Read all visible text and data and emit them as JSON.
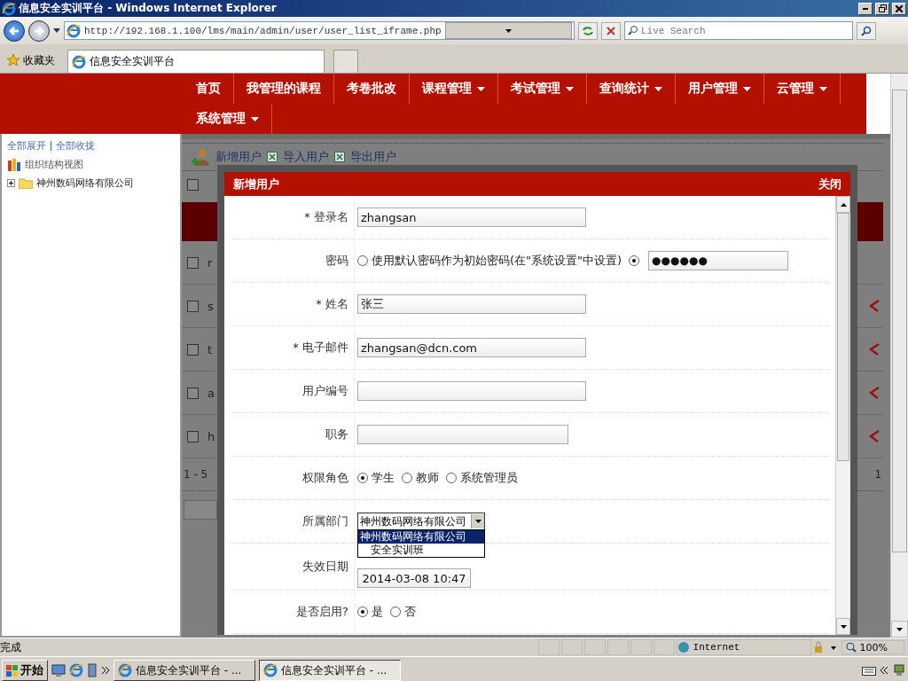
{
  "window": {
    "title": "信息安全实训平台 - Windows Internet Explorer"
  },
  "address_bar": {
    "url": "http://192.168.1.100/lms/main/admin/user/user_list_iframe.php"
  },
  "search": {
    "placeholder": "Live Search"
  },
  "favorites": {
    "label": "收藏夹"
  },
  "tabs": [
    {
      "label": "信息安全实训平台",
      "selected": true
    }
  ],
  "nav": [
    {
      "label": "首页",
      "dropdown": false
    },
    {
      "label": "我管理的课程",
      "dropdown": false
    },
    {
      "label": "考卷批改",
      "dropdown": false
    },
    {
      "label": "课程管理",
      "dropdown": true
    },
    {
      "label": "考试管理",
      "dropdown": true
    },
    {
      "label": "查询统计",
      "dropdown": true
    },
    {
      "label": "用户管理",
      "dropdown": true
    },
    {
      "label": "云管理",
      "dropdown": true
    },
    {
      "label": "系统管理",
      "dropdown": true
    }
  ],
  "sidebar": {
    "links": [
      "全部展开",
      "全部收拢"
    ],
    "root": "组织结构视图",
    "tree": [
      {
        "label": "神州数码网络有限公司",
        "expanded": false
      }
    ]
  },
  "list": {
    "toolbar": [
      "新增用户",
      "导入用户",
      "导出用户"
    ],
    "select_all": {
      "checked": false
    },
    "rows": [
      {
        "column_1": "r",
        "checked": false,
        "deletable": false
      },
      {
        "column_1": "s",
        "checked": false,
        "deletable": true
      },
      {
        "column_1": "t",
        "checked": false,
        "deletable": true
      },
      {
        "column_1": "a",
        "checked": false,
        "deletable": true
      },
      {
        "column_1": "h",
        "checked": false,
        "deletable": true
      }
    ],
    "pager": "1 - 5",
    "pager_end": "1"
  },
  "dialog": {
    "title": "新增用户",
    "close": "关闭",
    "rows": [
      {
        "kind": "text",
        "label": "* 登录名",
        "value": "zhangsan"
      },
      {
        "kind": "password",
        "label": "密码",
        "options": [
          {
            "label": "使用默认密码作为初始密码(在\"系统设置\"中设置)",
            "selected": false
          },
          {
            "selected": true
          }
        ],
        "value": "●●●●●●"
      },
      {
        "kind": "text",
        "label": "* 姓名",
        "value": "张三"
      },
      {
        "kind": "text",
        "label": "* 电子邮件",
        "value": "zhangsan@dcn.com"
      },
      {
        "kind": "text",
        "label": "用户编号"
      },
      {
        "kind": "short",
        "label": "职务"
      },
      {
        "kind": "radios",
        "label": "权限角色",
        "options": [
          {
            "label": "学生",
            "selected": true
          },
          {
            "label": "教师",
            "selected": false
          },
          {
            "label": "系统管理员",
            "selected": false
          }
        ]
      },
      {
        "kind": "select",
        "label": "所属部门",
        "value": "神州数码网络有限公司",
        "expanded": true,
        "options": [
          {
            "label": "神州数码网络有限公司",
            "selected": true
          },
          {
            "label": "安全实训班",
            "selected": false
          }
        ]
      },
      {
        "kind": "date",
        "label": "失效日期",
        "value": "2014-03-08 10:47"
      },
      {
        "kind": "radios",
        "label": "是否启用?",
        "options": [
          {
            "label": "是",
            "selected": true
          },
          {
            "label": "否",
            "selected": false
          }
        ]
      }
    ]
  },
  "status_bar": {
    "text": "完成",
    "zone": "Internet",
    "zoom": "100%"
  },
  "taskbar": {
    "start": "开始",
    "tasks": [
      {
        "label": "信息安全实训平台 - ...",
        "selected": false
      },
      {
        "label": "信息安全实训平台 - ...",
        "selected": true
      }
    ]
  }
}
